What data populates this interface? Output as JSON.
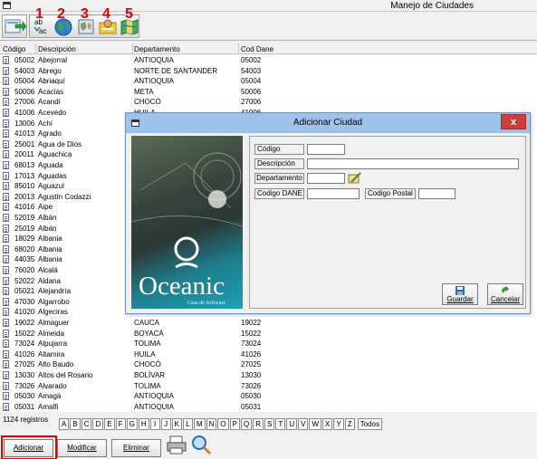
{
  "window": {
    "title": "Manejo de Ciudades"
  },
  "toolbar": {
    "numbers": [
      "1",
      "2",
      "3",
      "4",
      "5"
    ],
    "spell_label": "ab\nac"
  },
  "columns": [
    "Código",
    "Descripción",
    "Departamento",
    "Cod Dane"
  ],
  "rows": [
    [
      "05002",
      "Abejorral",
      "ANTIOQUIA",
      "05002"
    ],
    [
      "54003",
      "Abrego",
      "NORTE DE SANTANDER",
      "54003"
    ],
    [
      "05004",
      "Abriaquí",
      "ANTIOQUIA",
      "05004"
    ],
    [
      "50006",
      "Acacias",
      "META",
      "50006"
    ],
    [
      "27006",
      "Acandí",
      "CHOCÓ",
      "27006"
    ],
    [
      "41006",
      "Acevedo",
      "HUILA",
      "41006"
    ],
    [
      "13006",
      "Achí",
      "",
      ""
    ],
    [
      "41013",
      "Agrado",
      "",
      ""
    ],
    [
      "25001",
      "Agua de Dios",
      "",
      ""
    ],
    [
      "20011",
      "Aguachica",
      "",
      ""
    ],
    [
      "68013",
      "Aguada",
      "",
      ""
    ],
    [
      "17013",
      "Aguadas",
      "",
      ""
    ],
    [
      "85010",
      "Aguazul",
      "",
      ""
    ],
    [
      "20013",
      "Agustín Codazzi",
      "",
      ""
    ],
    [
      "41016",
      "Aipe",
      "",
      ""
    ],
    [
      "52019",
      "Albán",
      "",
      ""
    ],
    [
      "25019",
      "Albán",
      "",
      ""
    ],
    [
      "18029",
      "Albania",
      "",
      ""
    ],
    [
      "68020",
      "Albania",
      "",
      ""
    ],
    [
      "44035",
      "Albania",
      "",
      ""
    ],
    [
      "76020",
      "Alcalá",
      "",
      ""
    ],
    [
      "52022",
      "Aldana",
      "",
      ""
    ],
    [
      "05021",
      "Alejandría",
      "",
      ""
    ],
    [
      "47030",
      "Algarrobo",
      "",
      ""
    ],
    [
      "41020",
      "Algeciras",
      "HUILA",
      "41020"
    ],
    [
      "19022",
      "Almaguer",
      "CAUCA",
      "19022"
    ],
    [
      "15022",
      "Almeida",
      "BOYACÁ",
      "15022"
    ],
    [
      "73024",
      "Alpujarra",
      "TOLIMA",
      "73024"
    ],
    [
      "41026",
      "Altamira",
      "HUILA",
      "41026"
    ],
    [
      "27025",
      "Alto Baudo",
      "CHOCÓ",
      "27025"
    ],
    [
      "13030",
      "Altos del Rosario",
      "BOLÍVAR",
      "13030"
    ],
    [
      "73026",
      "Alvarado",
      "TOLIMA",
      "73026"
    ],
    [
      "05030",
      "Amagá",
      "ANTIOQUIA",
      "05030"
    ],
    [
      "05031",
      "Amalfi",
      "ANTIOQUIA",
      "05031"
    ]
  ],
  "footer": {
    "registros": "1124 registros",
    "letters": [
      "A",
      "B",
      "C",
      "D",
      "E",
      "F",
      "G",
      "H",
      "I",
      "J",
      "K",
      "L",
      "M",
      "N",
      "O",
      "P",
      "Q",
      "R",
      "S",
      "T",
      "U",
      "V",
      "W",
      "X",
      "Y",
      "Z",
      "Todos"
    ],
    "adicionar": "Adicionar",
    "modificar": "Modificar",
    "eliminar": "Eliminar"
  },
  "dialog": {
    "title": "Adicionar Ciudad",
    "close": "x",
    "logo_text": "Oceanic",
    "logo_sub": "Casa de Software",
    "codigo_label": "Código",
    "descripcion_label": "Descripción",
    "departamento_label": "Departamento",
    "codigo_dane_label": "Codigo DANE",
    "codigo_postal_label": "Codigo Postal",
    "guardar": "Guardar",
    "cancelar": "Cancelar"
  }
}
